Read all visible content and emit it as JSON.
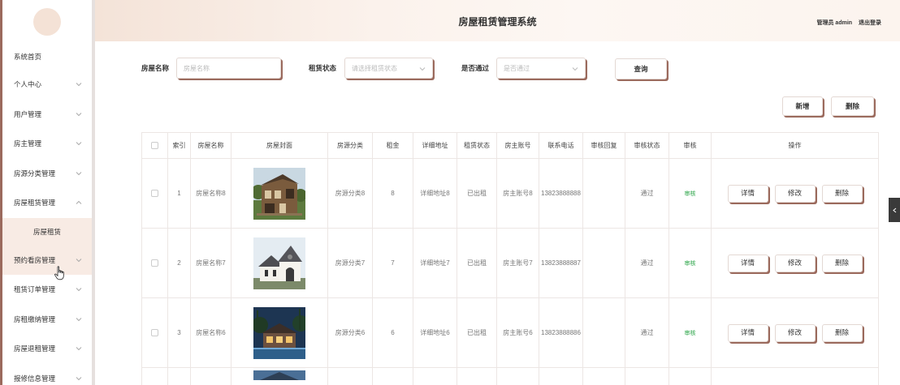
{
  "header": {
    "app_title": "房屋租赁管理系统",
    "user_label": "管理员 admin",
    "logout_label": "退出登录"
  },
  "sidebar": {
    "items": [
      {
        "label": "系统首页",
        "expandable": false
      },
      {
        "label": "个人中心",
        "expandable": true
      },
      {
        "label": "用户管理",
        "expandable": true
      },
      {
        "label": "房主管理",
        "expandable": true
      },
      {
        "label": "房源分类管理",
        "expandable": true
      },
      {
        "label": "房屋租赁管理",
        "expandable": true,
        "expanded": true
      },
      {
        "label": "房屋租赁",
        "sub": true,
        "active": true
      },
      {
        "label": "预约看房管理",
        "expandable": true,
        "hover": true
      },
      {
        "label": "租赁订单管理",
        "expandable": true
      },
      {
        "label": "房租缴纳管理",
        "expandable": true
      },
      {
        "label": "房屋退租管理",
        "expandable": true
      },
      {
        "label": "报修信息管理",
        "expandable": true
      }
    ]
  },
  "search": {
    "name_label": "房屋名称",
    "name_placeholder": "房屋名称",
    "status_label": "租赁状态",
    "status_placeholder": "请选择租赁状态",
    "passed_label": "是否通过",
    "passed_placeholder": "是否通过",
    "query_button": "查询"
  },
  "toolbar": {
    "add_button": "新增",
    "delete_button": "删除"
  },
  "table": {
    "columns": [
      "索引",
      "房屋名称",
      "房屋封面",
      "房源分类",
      "租金",
      "详细地址",
      "租赁状态",
      "房主账号",
      "联系电话",
      "审核回复",
      "审核状态",
      "审核",
      "操作"
    ],
    "rows": [
      {
        "index": "1",
        "name": "房屋名称8",
        "category": "房源分类8",
        "rent": "8",
        "address": "详细地址8",
        "status": "已出租",
        "owner": "房主账号8",
        "phone": "13823888888",
        "reply": "",
        "audit_status": "通过",
        "audit_action": "审核",
        "image": "wood-house"
      },
      {
        "index": "2",
        "name": "房屋名称7",
        "category": "房源分类7",
        "rent": "7",
        "address": "详细地址7",
        "status": "已出租",
        "owner": "房主账号7",
        "phone": "13823888887",
        "reply": "",
        "audit_status": "通过",
        "audit_action": "审核",
        "image": "white-chapel"
      },
      {
        "index": "3",
        "name": "房屋名称6",
        "category": "房源分类6",
        "rent": "6",
        "address": "详细地址6",
        "status": "已出租",
        "owner": "房主账号6",
        "phone": "13823888886",
        "reply": "",
        "audit_status": "通过",
        "audit_action": "审核",
        "image": "night-villa"
      }
    ],
    "row_buttons": {
      "detail": "详情",
      "edit": "修改",
      "delete": "删除"
    }
  }
}
